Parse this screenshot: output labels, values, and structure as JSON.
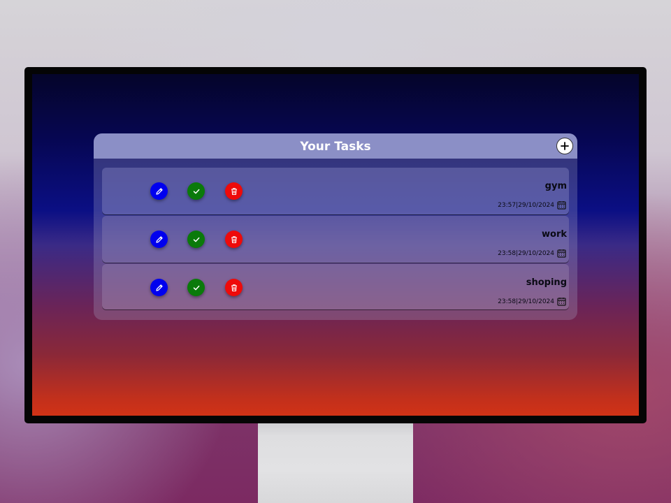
{
  "app": {
    "title": "Your Tasks",
    "add_icon": "plus-icon"
  },
  "colors": {
    "edit_button": "#0000ee",
    "done_button": "#0a7a0a",
    "delete_button": "#ee0a0a",
    "header_bg": "#8b8fc6"
  },
  "icons": {
    "edit": "pencil-icon",
    "done": "check-icon",
    "delete": "trash-icon",
    "date": "calendar-icon"
  },
  "tasks": [
    {
      "name": "gym",
      "timestamp": "23:57|29/10/2024"
    },
    {
      "name": "work",
      "timestamp": "23:58|29/10/2024"
    },
    {
      "name": "shoping",
      "timestamp": "23:58|29/10/2024"
    }
  ]
}
